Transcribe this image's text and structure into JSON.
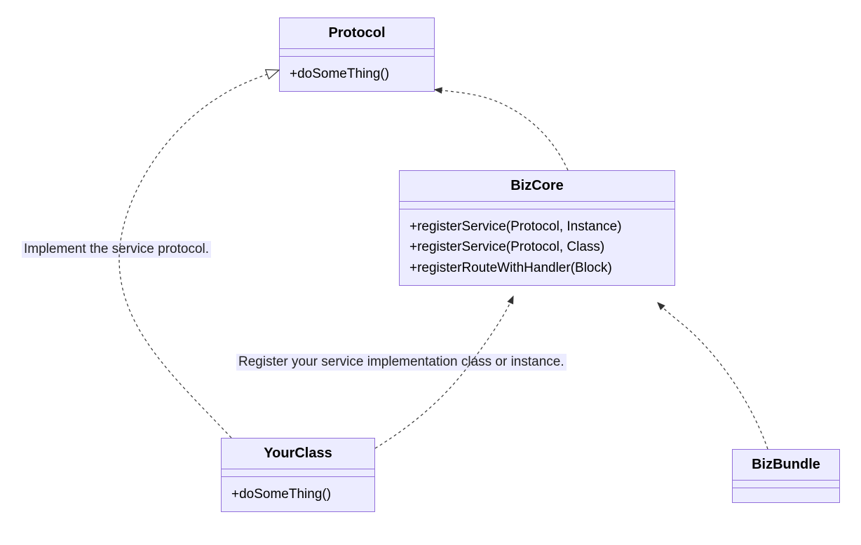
{
  "classes": {
    "protocol": {
      "name": "Protocol",
      "methods": [
        "+doSomeThing()"
      ]
    },
    "bizcore": {
      "name": "BizCore",
      "methods": [
        "+registerService(Protocol, Instance)",
        "+registerService(Protocol, Class)",
        "+registerRouteWithHandler(Block)"
      ]
    },
    "yourclass": {
      "name": "YourClass",
      "methods": [
        "+doSomeThing()"
      ]
    },
    "bizbundle": {
      "name": "BizBundle",
      "methods": []
    }
  },
  "labels": {
    "implement": "Implement the service protocol.",
    "register": "Register your service implementation class or instance."
  }
}
